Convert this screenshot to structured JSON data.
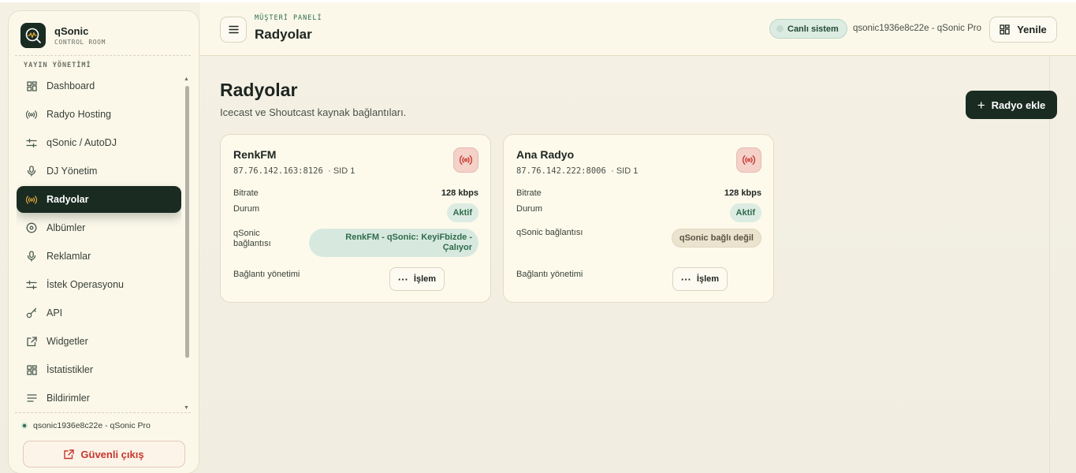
{
  "brand": {
    "name": "qSonic",
    "subtitle": "CONTROL ROOM"
  },
  "sidebar": {
    "section_label": "YAYIN YÖNETİMİ",
    "items": [
      {
        "label": "Dashboard",
        "icon": "grid-icon"
      },
      {
        "label": "Radyo Hosting",
        "icon": "broadcast-icon"
      },
      {
        "label": "qSonic / AutoDJ",
        "icon": "sliders-icon"
      },
      {
        "label": "DJ Yönetim",
        "icon": "microphone-icon"
      },
      {
        "label": "Radyolar",
        "icon": "broadcast-icon",
        "active": true
      },
      {
        "label": "Albümler",
        "icon": "disc-icon"
      },
      {
        "label": "Reklamlar",
        "icon": "microphone-icon"
      },
      {
        "label": "İstek Operasyonu",
        "icon": "sliders-icon"
      },
      {
        "label": "API",
        "icon": "key-icon"
      },
      {
        "label": "Widgetler",
        "icon": "external-link-icon"
      },
      {
        "label": "İstatistikler",
        "icon": "grid-icon"
      },
      {
        "label": "Bildirimler",
        "icon": "list-icon"
      }
    ],
    "user": "qsonic1936e8c22e - qSonic Pro",
    "logout_label": "Güvenli çıkış"
  },
  "header": {
    "kicker": "MÜŞTERİ PANELİ",
    "title": "Radyolar",
    "live_badge": "Canlı sistem",
    "account": "qsonic1936e8c22e - qSonic Pro",
    "refresh_label": "Yenile"
  },
  "main": {
    "title": "Radyolar",
    "subtitle": "Icecast ve Shoutcast kaynak bağlantıları.",
    "add_label": "Radyo ekle",
    "labels": {
      "bitrate": "Bitrate",
      "status": "Durum",
      "connection": "qSonic bağlantısı",
      "management": "Bağlantı yönetimi",
      "action": "İşlem"
    },
    "cards": [
      {
        "name": "RenkFM",
        "address": "87.76.142.163:8126",
        "sid": "· SID 1",
        "bitrate": "128 kbps",
        "status": "Aktif",
        "connection": "RenkFM - qSonic: KeyiFbizde - Çalıyor",
        "connected": true
      },
      {
        "name": "Ana Radyo",
        "address": "87.76.142.222:8006",
        "sid": "· SID 1",
        "bitrate": "128 kbps",
        "status": "Aktif",
        "connection": "qSonic bağlı değil",
        "connected": false
      }
    ]
  },
  "colors": {
    "accent_dark": "#1a2b22",
    "accent_green": "#2f6b4c",
    "danger": "#c7372d",
    "radio_icon_bg": "#f4d1c9"
  }
}
